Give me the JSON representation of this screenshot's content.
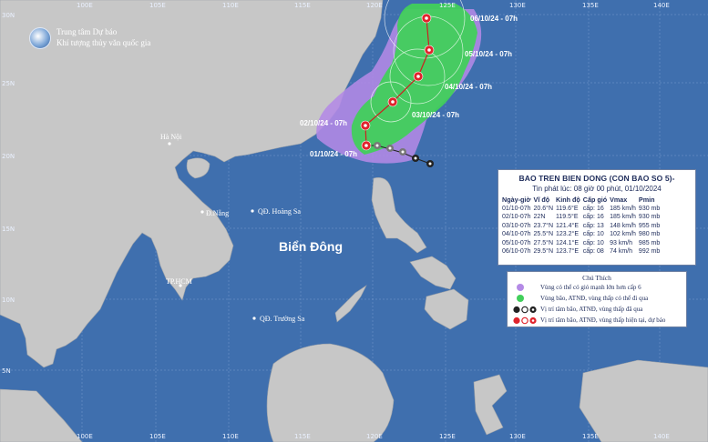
{
  "org": {
    "line1": "Trung tâm Dự báo",
    "line2": "Khí tượng thủy văn quốc gia"
  },
  "map_labels": {
    "longitude_ticks": [
      "100E",
      "105E",
      "110E",
      "115E",
      "120E",
      "125E",
      "130E",
      "135E",
      "140E"
    ],
    "latitude_ticks": [
      "30N",
      "25N",
      "20N",
      "15N",
      "10N",
      "5N"
    ],
    "sea_name": "Biển Đông",
    "places": {
      "hanoi": "Hà Nội",
      "danang": "Đ.Nẵng",
      "hoangsa": "QĐ. Hoàng Sa",
      "hcm": "TP.HCM",
      "truongsa": "QĐ. Trường Sa"
    }
  },
  "forecast_dates": [
    "01/10/24 - 07h",
    "02/10/24 - 07h",
    "03/10/24 - 07h",
    "04/10/24 - 07h",
    "05/10/24 - 07h",
    "06/10/24 - 07h"
  ],
  "panel": {
    "title": "BAO TREN BIEN DONG (CON BAO SO 5)-",
    "issued": "Tin phát lúc: 08 giờ 00 phút, 01/10/2024",
    "headers": [
      "Ngày-giờ",
      "Vĩ độ",
      "Kinh độ",
      "Cấp gió",
      "Vmax",
      "Pmin"
    ],
    "rows": [
      [
        "01/10-07h",
        "20.6°N",
        "119.6°E",
        "cấp: 16",
        "185 km/h",
        "930 mb"
      ],
      [
        "02/10-07h",
        "22N",
        "119.5°E",
        "cấp: 16",
        "185 km/h",
        "930 mb"
      ],
      [
        "03/10-07h",
        "23.7°N",
        "121.4°E",
        "cấp: 13",
        "148 km/h",
        "955 mb"
      ],
      [
        "04/10-07h",
        "25.5°N",
        "123.2°E",
        "cấp: 10",
        "102 km/h",
        "980 mb"
      ],
      [
        "05/10-07h",
        "27.5°N",
        "124.1°E",
        "cấp: 10",
        "93 km/h",
        "985 mb"
      ],
      [
        "06/10-07h",
        "29.5°N",
        "123.7°E",
        "cấp: 08",
        "74 km/h",
        "992 mb"
      ]
    ]
  },
  "legend": {
    "title": "Chú Thích",
    "items": [
      "Vùng có thể có gió mạnh lớn hơn cấp 6",
      "Vùng bão, ATNĐ, vùng thấp có thể đi qua",
      "Vị trí tâm bão, ATNĐ, vùng thấp đã qua",
      "Vị trí tâm bão, ATNĐ, vùng thấp hiện tại, dự báo"
    ]
  },
  "colors": {
    "sea": "#3f6fae",
    "land": "#c7c7c7",
    "wind_zone": "#b48ae6",
    "cone": "#41cf5b",
    "forecast_symbol": "#e0242c",
    "past_symbol": "#222222"
  }
}
